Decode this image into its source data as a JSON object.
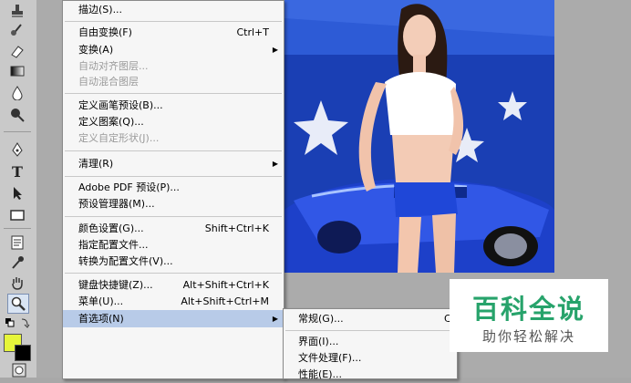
{
  "toolbar": {
    "tools": [
      "stamp-icon",
      "history-brush-icon",
      "eraser-icon",
      "gradient-icon",
      "blur-icon",
      "dodge-icon",
      "pen-icon",
      "type-icon",
      "path-select-icon",
      "rectangle-icon",
      "notes-icon",
      "eyedropper-icon",
      "hand-icon",
      "zoom-icon"
    ],
    "type_tool_glyph": "T",
    "foreground_color": "#e6f53a",
    "background_color": "#000000"
  },
  "menu": {
    "items": [
      {
        "label": "描边(S)...",
        "shortcut": "",
        "disabled": false
      },
      {
        "label": "自由变换(F)",
        "shortcut": "Ctrl+T",
        "disabled": false
      },
      {
        "label": "变换(A)",
        "shortcut": "",
        "disabled": false,
        "submenu": true
      },
      {
        "label": "自动对齐图层...",
        "shortcut": "",
        "disabled": true
      },
      {
        "label": "自动混合图层",
        "shortcut": "",
        "disabled": true
      },
      {
        "label": "定义画笔预设(B)...",
        "shortcut": "",
        "disabled": false
      },
      {
        "label": "定义图案(Q)...",
        "shortcut": "",
        "disabled": false
      },
      {
        "label": "定义自定形状(J)...",
        "shortcut": "",
        "disabled": true
      },
      {
        "label": "清理(R)",
        "shortcut": "",
        "disabled": false,
        "submenu": true
      },
      {
        "label": "Adobe PDF 预设(P)...",
        "shortcut": "",
        "disabled": false
      },
      {
        "label": "预设管理器(M)...",
        "shortcut": "",
        "disabled": false
      },
      {
        "label": "颜色设置(G)...",
        "shortcut": "Shift+Ctrl+K",
        "disabled": false
      },
      {
        "label": "指定配置文件...",
        "shortcut": "",
        "disabled": false
      },
      {
        "label": "转换为配置文件(V)...",
        "shortcut": "",
        "disabled": false
      },
      {
        "label": "键盘快捷键(Z)...",
        "shortcut": "Alt+Shift+Ctrl+K",
        "disabled": false
      },
      {
        "label": "菜单(U)...",
        "shortcut": "Alt+Shift+Ctrl+M",
        "disabled": false
      },
      {
        "label": "首选项(N)",
        "shortcut": "",
        "disabled": false,
        "submenu": true,
        "selected": true
      }
    ]
  },
  "submenu": {
    "items": [
      {
        "label": "常规(G)...",
        "shortcut": "C"
      },
      {
        "label": "界面(I)...",
        "shortcut": ""
      },
      {
        "label": "文件处理(F)...",
        "shortcut": ""
      },
      {
        "label": "性能(E)...",
        "shortcut": ""
      }
    ]
  },
  "watermark": {
    "title": "百科全说",
    "subtitle": "助你轻松解决"
  }
}
